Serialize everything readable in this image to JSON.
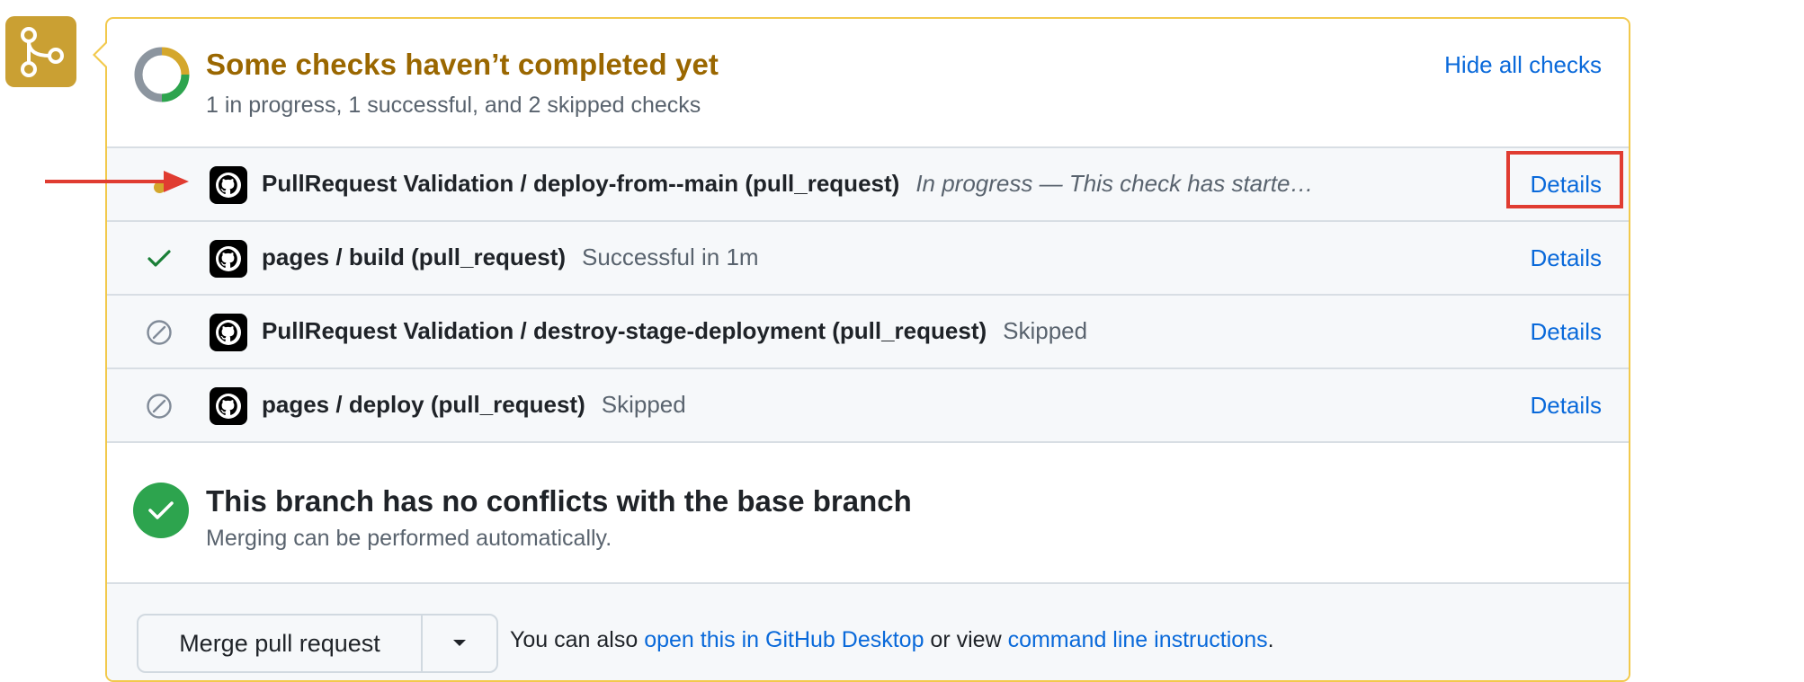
{
  "colors": {
    "warning": "#9a6700",
    "link": "#0969da",
    "success": "#2da44e",
    "annotation_red": "#e03c31",
    "merge_badge": "#caa033"
  },
  "badge": {
    "icon": "git-merge-icon"
  },
  "status": {
    "title": "Some checks haven’t completed yet",
    "summary": "1 in progress, 1 successful, and 2 skipped checks",
    "hide_all_label": "Hide all checks",
    "progress": {
      "in_progress": 1,
      "successful": 1,
      "skipped": 2
    }
  },
  "checks": [
    {
      "status": "in-progress",
      "name": "PullRequest Validation / deploy-from--main (pull_request)",
      "description": "In progress — This check has starte…",
      "details_label": "Details"
    },
    {
      "status": "success",
      "name": "pages / build (pull_request)",
      "description": "Successful in 1m",
      "details_label": "Details"
    },
    {
      "status": "skipped",
      "name": "PullRequest Validation / destroy-stage-deployment (pull_request)",
      "description": "Skipped",
      "details_label": "Details"
    },
    {
      "status": "skipped",
      "name": "pages / deploy (pull_request)",
      "description": "Skipped",
      "details_label": "Details"
    }
  ],
  "merge_status": {
    "title": "This branch has no conflicts with the base branch",
    "subtitle": "Merging can be performed automatically."
  },
  "actions": {
    "merge_label": "Merge pull request",
    "hint_prefix": "You can also ",
    "desktop_link": "open this in GitHub Desktop",
    "hint_middle": " or view ",
    "cli_link": "command line instructions",
    "hint_suffix": "."
  }
}
